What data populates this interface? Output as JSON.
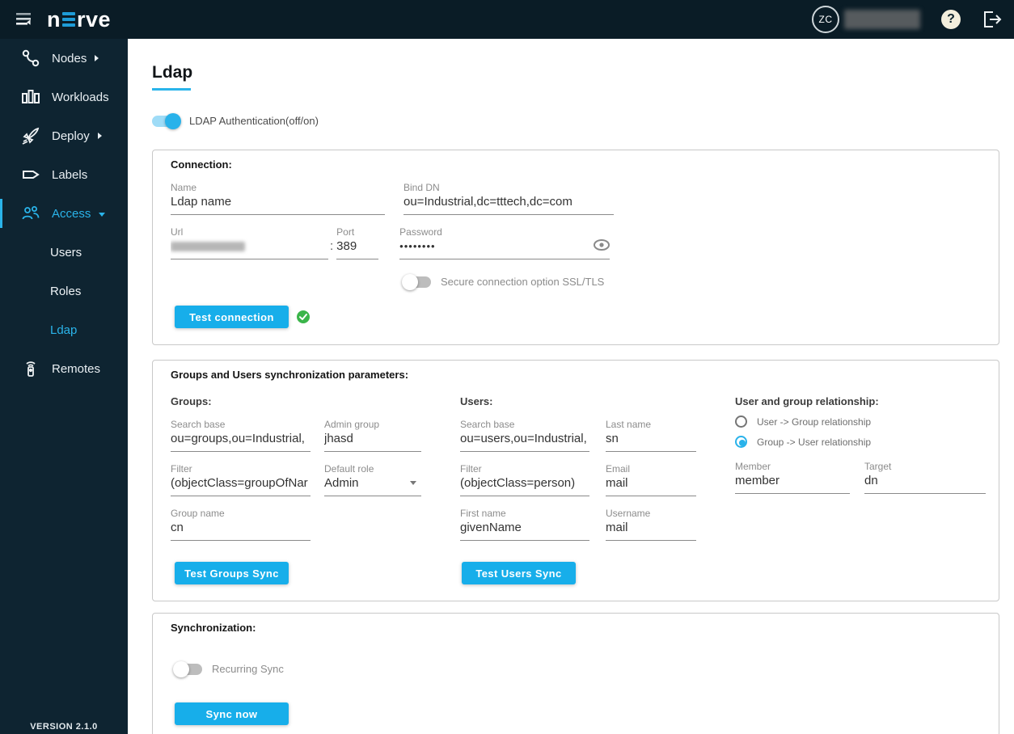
{
  "colors": {
    "topbar_bg": "#0a1c26",
    "sidebar_bg": "#0e2431",
    "accent_blue": "#2ab4ea",
    "button_blue": "#17aeea",
    "success_green": "#3bb54a"
  },
  "topbar": {
    "brand_left": "n",
    "brand_right": "rve",
    "avatar_initials": "ZC",
    "help_glyph": "?"
  },
  "sidebar": {
    "items": [
      {
        "label": "Nodes"
      },
      {
        "label": "Workloads"
      },
      {
        "label": "Deploy"
      },
      {
        "label": "Labels"
      },
      {
        "label": "Access"
      },
      {
        "label": "Users"
      },
      {
        "label": "Roles"
      },
      {
        "label": "Ldap"
      },
      {
        "label": "Remotes"
      }
    ],
    "version": "VERSION 2.1.0"
  },
  "page": {
    "title": "Ldap",
    "ldap_toggle_label": "LDAP Authentication(off/on)"
  },
  "connection": {
    "section_title": "Connection:",
    "name": {
      "label": "Name",
      "value": "Ldap name"
    },
    "bind_dn": {
      "label": "Bind DN",
      "value": "ou=Industrial,dc=tttech,dc=com"
    },
    "url": {
      "label": "Url"
    },
    "port_separator": ":",
    "port": {
      "label": "Port",
      "value": "389"
    },
    "password": {
      "label": "Password",
      "value": "••••••••"
    },
    "ssl_toggle_label": "Secure connection option SSL/TLS",
    "test_button": "Test connection"
  },
  "sync_params": {
    "section_title": "Groups and Users synchronization parameters:",
    "groups": {
      "heading": "Groups:",
      "search_base": {
        "label": "Search base",
        "value": "ou=groups,ou=Industrial,"
      },
      "admin_group": {
        "label": "Admin group",
        "value": "jhasd"
      },
      "filter": {
        "label": "Filter",
        "value": "(objectClass=groupOfNar"
      },
      "default_role": {
        "label": "Default role",
        "value": "Admin"
      },
      "group_name": {
        "label": "Group name",
        "value": "cn"
      }
    },
    "users": {
      "heading": "Users:",
      "search_base": {
        "label": "Search base",
        "value": "ou=users,ou=Industrial,"
      },
      "last_name": {
        "label": "Last name",
        "value": "sn"
      },
      "filter": {
        "label": "Filter",
        "value": "(objectClass=person)"
      },
      "email": {
        "label": "Email",
        "value": "mail"
      },
      "first_name": {
        "label": "First name",
        "value": "givenName"
      },
      "username": {
        "label": "Username",
        "value": "mail"
      }
    },
    "relationship": {
      "heading": "User and group relationship:",
      "options": [
        {
          "label": "User -> Group relationship",
          "selected": false
        },
        {
          "label": "Group -> User relationship",
          "selected": true
        }
      ],
      "member": {
        "label": "Member",
        "value": "member"
      },
      "target": {
        "label": "Target",
        "value": "dn"
      }
    },
    "test_groups_button": "Test Groups Sync",
    "test_users_button": "Test Users Sync"
  },
  "synchronization": {
    "section_title": "Synchronization:",
    "recurring_label": "Recurring Sync",
    "sync_button": "Sync now"
  }
}
